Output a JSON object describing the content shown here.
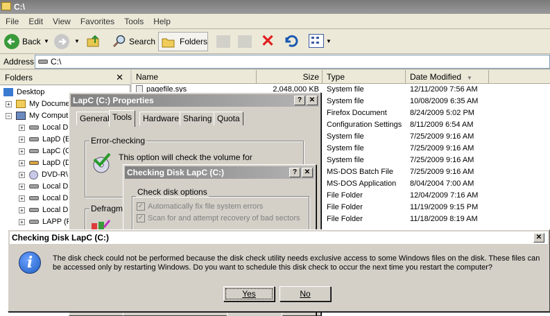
{
  "window": {
    "title": "C:\\"
  },
  "menu": [
    "File",
    "Edit",
    "View",
    "Favorites",
    "Tools",
    "Help"
  ],
  "toolbar": {
    "back": "Back",
    "search": "Search",
    "folders": "Folders"
  },
  "address": {
    "label": "Address",
    "value": "C:\\"
  },
  "folders": {
    "header": "Folders",
    "close": "✕",
    "items": [
      "Desktop",
      "My Docume",
      "My Comput",
      "Local D",
      "LapD (E",
      "LapC (C",
      "LapD (D",
      "DVD-R\\",
      "Local D",
      "Local D",
      "Local D",
      "LAPP (F"
    ]
  },
  "list": {
    "columns": [
      "Name",
      "Size",
      "Type",
      "Date Modified"
    ],
    "first_row": {
      "name": "pagefile.sys",
      "size": "2,048,000 KB"
    },
    "types": [
      "System file",
      "System file",
      "Firefox Document",
      "Configuration Settings",
      "System file",
      "System file",
      "System file",
      "MS-DOS Batch File",
      "MS-DOS Application",
      "File Folder",
      "File Folder",
      "File Folder"
    ],
    "dates": [
      "12/11/2009 7:56 AM",
      "10/08/2009 6:35 AM",
      "8/24/2009 5:02 PM",
      "8/11/2009 6:54 AM",
      "7/25/2009 9:16 AM",
      "7/25/2009 9:16 AM",
      "7/25/2009 9:16 AM",
      "7/25/2009 9:16 AM",
      "8/04/2004 7:00 AM",
      "12/04/2009 7:16 AM",
      "11/19/2009 9:15 PM",
      "11/18/2009 8:19 AM"
    ]
  },
  "properties": {
    "title": "LapC (C:) Properties",
    "tabs": [
      "General",
      "Tools",
      "Hardware",
      "Sharing",
      "Quota"
    ],
    "error_group": "Error-checking",
    "error_text": "This option will check the volume for",
    "defrag_group": "Defragme"
  },
  "checkdisk": {
    "title": "Checking Disk LapC (C:)",
    "group": "Check disk options",
    "opt1": "Automatically fix file system errors",
    "opt2": "Scan for and attempt recovery of bad sectors"
  },
  "message": {
    "title": "Checking Disk LapC (C:)",
    "text": "The disk check could not be performed because the disk check utility needs exclusive access to some Windows files on the disk. These files can be accessed only by restarting Windows. Do you want to schedule this disk check to occur the next time you restart the computer?",
    "yes": "Yes",
    "no": "No"
  },
  "colors": {
    "info_blue": "#1f5fc2",
    "title_grey": "#8a8a8a"
  }
}
